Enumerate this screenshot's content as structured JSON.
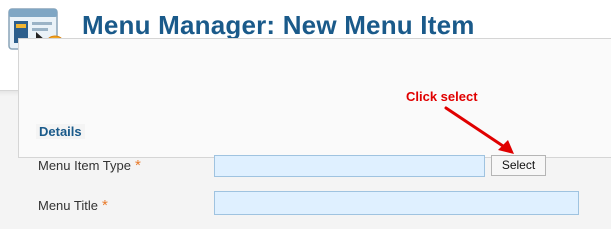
{
  "header": {
    "title": "Menu Manager: New Menu Item",
    "icon": "menu-add-icon"
  },
  "form": {
    "legend": "Details",
    "fields": [
      {
        "label": "Menu Item Type",
        "required_mark": "*",
        "value": ""
      },
      {
        "label": "Menu Title",
        "required_mark": "*",
        "value": ""
      }
    ],
    "select_button_label": "Select"
  },
  "annotation": {
    "text": "Click select",
    "color": "#e00000"
  },
  "colors": {
    "title": "#1a5a8a",
    "required": "#e87a2a",
    "input_bg": "#dff0ff"
  }
}
